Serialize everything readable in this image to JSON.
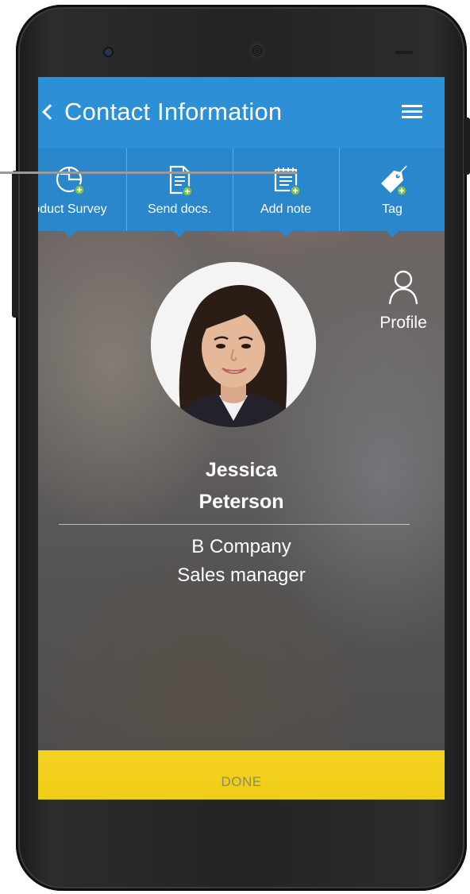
{
  "header": {
    "title": "Contact Information"
  },
  "actions": [
    {
      "label": "oduct Survey",
      "icon": "survey-icon"
    },
    {
      "label": "Send docs.",
      "icon": "document-icon"
    },
    {
      "label": "Add note",
      "icon": "note-icon"
    },
    {
      "label": "Tag",
      "icon": "tag-icon"
    }
  ],
  "profile": {
    "label": "Profile",
    "icon": "user-icon"
  },
  "contact": {
    "first_name": "Jessica",
    "last_name": "Peterson",
    "company": "B Company",
    "role": "Sales manager"
  },
  "footer": {
    "done_label": "DONE"
  },
  "colors": {
    "primary": "#2d8fd6",
    "accent": "#f2cf1a"
  }
}
